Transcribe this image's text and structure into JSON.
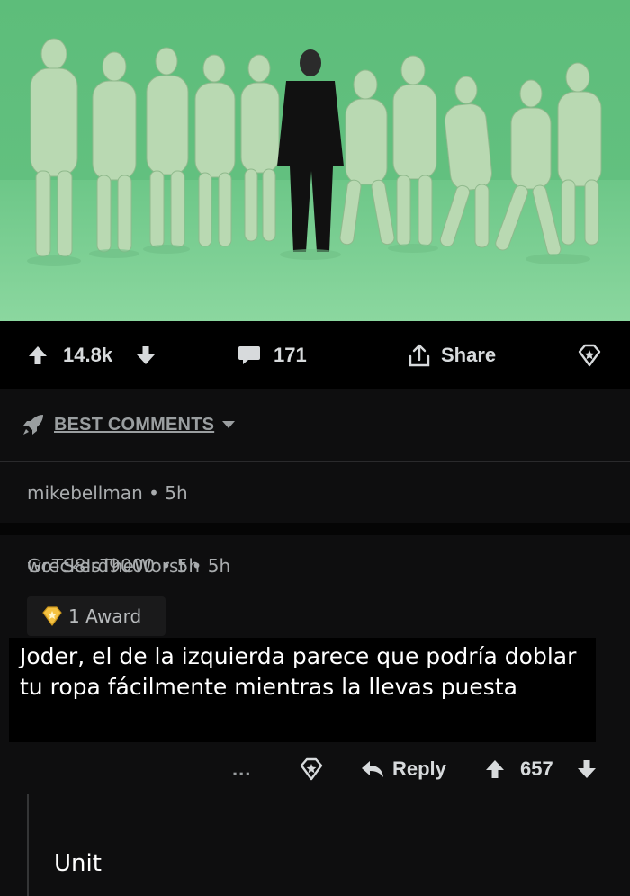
{
  "photo": {
    "alt_subject": "",
    "background_color": "#63c282"
  },
  "action_bar": {
    "upvotes": "14.8k",
    "comments": "171",
    "share_label": "Share",
    "icons": [
      "arrow-up-icon",
      "arrow-down-icon",
      "comment-icon",
      "share-icon",
      "award-icon"
    ]
  },
  "sort": {
    "label": "BEST COMMENTS",
    "icons": [
      "rocket-icon",
      "caret-down-icon"
    ]
  },
  "comments": [
    {
      "author": "mikebellman",
      "age": "5h",
      "collapsed": true
    },
    {
      "author": "GoTS8IsTheWorst",
      "age": "5h",
      "award": "1 Award",
      "body": "Joder, el de la izquierda parece que podría doblar tu ropa fácilmente mientras la llevas puesta",
      "more": "...",
      "reply_label": "Reply",
      "score": "657",
      "replies": [
        {
          "author": "wreckerd9000",
          "age": "5h",
          "body": "Unit"
        }
      ]
    }
  ],
  "colors": {
    "background": "#000000",
    "panel": "#0e0e0f",
    "text": "#d7dadc",
    "muted": "#a9acae",
    "award_gold": "#f5c242"
  }
}
